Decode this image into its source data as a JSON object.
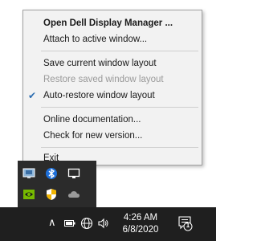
{
  "menu": {
    "items": [
      {
        "label": "Open Dell Display Manager ...",
        "bold": true
      },
      {
        "label": "Attach to active window..."
      },
      {
        "label": "Save current window layout"
      },
      {
        "label": "Restore saved window layout",
        "disabled": true
      },
      {
        "label": "Auto-restore window layout",
        "checked": true
      },
      {
        "label": "Online documentation..."
      },
      {
        "label": "Check for new version..."
      },
      {
        "label": "Exit"
      }
    ],
    "check_mark": "✔"
  },
  "taskbar": {
    "time": "4:26 AM",
    "date": "6/8/2020",
    "notification_count": "1"
  },
  "colors": {
    "menu_bg": "#f2f2f2",
    "taskbar_bg": "#1f1f1f",
    "tray_panel_bg": "#2b2b2b",
    "check": "#2b6cb0"
  }
}
